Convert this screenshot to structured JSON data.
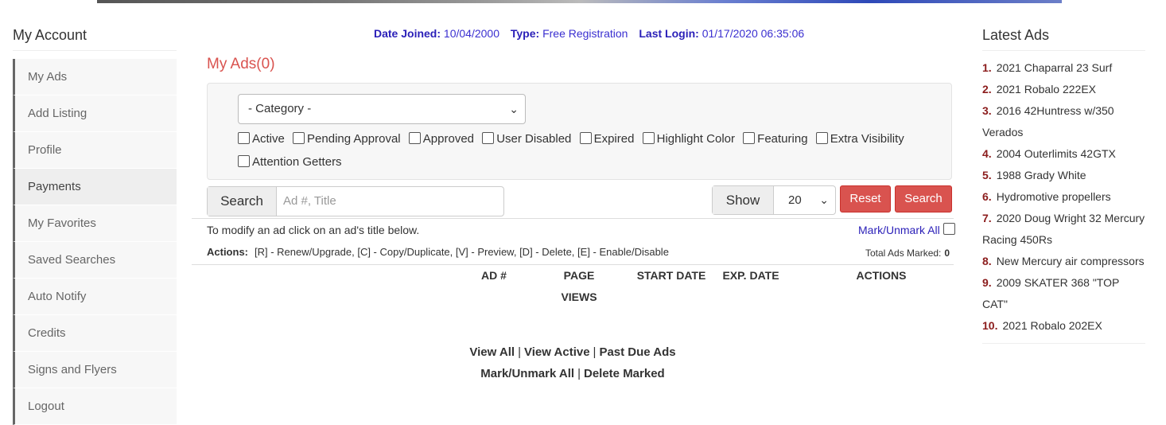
{
  "account": {
    "heading": "My Account",
    "items": [
      "My Ads",
      "Add Listing",
      "Profile",
      "Payments",
      "My Favorites",
      "Saved Searches",
      "Auto Notify",
      "Credits",
      "Signs and Flyers",
      "Logout"
    ]
  },
  "info": {
    "date_joined_label": "Date Joined:",
    "date_joined": "10/04/2000",
    "type_label": "Type:",
    "type": "Free Registration",
    "last_login_label": "Last Login:",
    "last_login": "01/17/2020 06:35:06"
  },
  "title": "My Ads(0)",
  "filter": {
    "category_selected": "- Category -",
    "checkboxes": [
      "Active",
      "Pending Approval",
      "Approved",
      "User Disabled",
      "Expired",
      "Highlight Color",
      "Featuring",
      "Extra Visibility",
      "Attention Getters"
    ]
  },
  "search": {
    "label": "Search",
    "placeholder": "Ad #, Title"
  },
  "show": {
    "label": "Show",
    "value": "20"
  },
  "buttons": {
    "reset": "Reset",
    "search": "Search"
  },
  "hint": "To modify an ad click on an ad's title below.",
  "mark_unmark_all": "Mark/Unmark All",
  "actions": {
    "label": "Actions:",
    "text": "[R] - Renew/Upgrade, [C] - Copy/Duplicate, [V] - Preview, [D] - Delete, [E] - Enable/Disable"
  },
  "total_marked": {
    "label": "Total Ads Marked:",
    "value": "0"
  },
  "table_headers": {
    "ad": "AD #",
    "page": "PAGE",
    "views": "VIEWS",
    "start": "START DATE",
    "exp": "EXP. DATE",
    "actions": "ACTIONS"
  },
  "links": {
    "view_all": "View All",
    "view_active": "View Active",
    "past_due": "Past Due Ads",
    "mark_unmark": "Mark/Unmark All",
    "delete_marked": "Delete Marked",
    "sep": "|"
  },
  "latest": {
    "heading": "Latest Ads",
    "items": [
      {
        "num": "1.",
        "text": "2021 Chaparral 23 Surf"
      },
      {
        "num": "2.",
        "text": "2021 Robalo 222EX"
      },
      {
        "num": "3.",
        "text": "2016 42Huntress w/350 Verados"
      },
      {
        "num": "4.",
        "text": "2004 Outerlimits 42GTX"
      },
      {
        "num": "5.",
        "text": "1988 Grady White"
      },
      {
        "num": "6.",
        "text": "Hydromotive propellers"
      },
      {
        "num": "7.",
        "text": "2020 Doug Wright 32 Mercury Racing 450Rs"
      },
      {
        "num": "8.",
        "text": "New Mercury air compressors"
      },
      {
        "num": "9.",
        "text": "2009 SKATER 368 \"TOP CAT\""
      },
      {
        "num": "10.",
        "text": "2021 Robalo 202EX"
      }
    ]
  }
}
